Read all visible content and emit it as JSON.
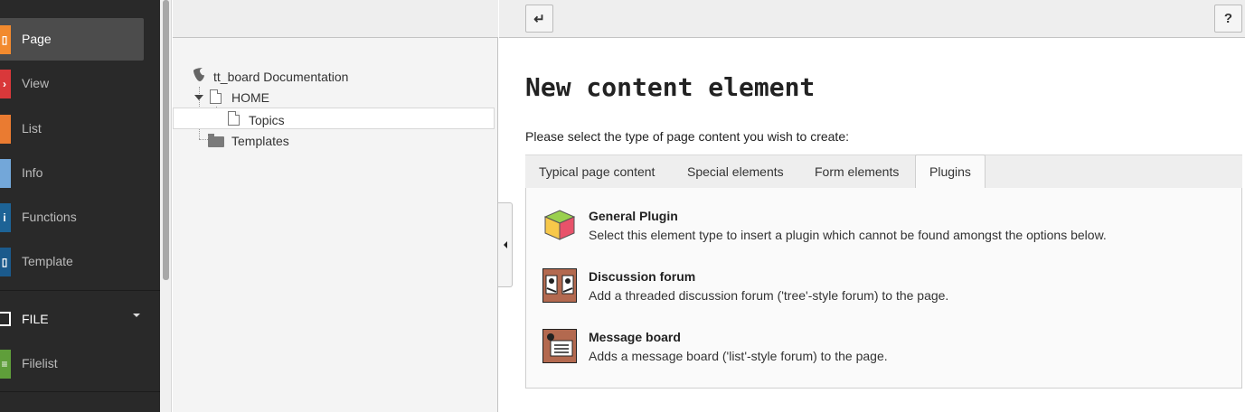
{
  "module_menu": {
    "items": [
      {
        "label": "Page",
        "color": "#f28a2e",
        "icon": "page-module-icon",
        "active": true
      },
      {
        "label": "View",
        "color": "#d9383a",
        "icon": "view-module-icon"
      },
      {
        "label": "List",
        "color": "#ea7b31",
        "icon": "list-module-icon"
      },
      {
        "label": "Info",
        "color": "#73a7d9",
        "icon": "info-module-icon"
      },
      {
        "label": "Functions",
        "color": "#1d6396",
        "icon": "functions-module-icon"
      },
      {
        "label": "Template",
        "color": "#1b5a8c",
        "icon": "template-module-icon"
      }
    ],
    "group_label": "FILE",
    "file_items": [
      {
        "label": "Filelist",
        "color": "#5f9e3a",
        "icon": "filelist-module-icon"
      }
    ]
  },
  "page_tree": {
    "root": "tt_board Documentation",
    "nodes": [
      {
        "label": "HOME",
        "icon": "page-icon"
      },
      {
        "label": "Topics",
        "icon": "page-icon",
        "selected": true
      },
      {
        "label": "Templates",
        "icon": "folder-icon"
      }
    ]
  },
  "docheader": {
    "back_icon": "↵",
    "help_icon": "?"
  },
  "content": {
    "title": "New content element",
    "intro": "Please select the type of page content you wish to create:",
    "tabs": [
      {
        "label": "Typical page content"
      },
      {
        "label": "Special elements"
      },
      {
        "label": "Form elements"
      },
      {
        "label": "Plugins",
        "active": true
      }
    ],
    "plugins": [
      {
        "title": "General Plugin",
        "desc": "Select this element type to insert a plugin which cannot be found amongst the options below.",
        "icon": "cube-plugin-icon"
      },
      {
        "title": "Discussion forum",
        "desc": "Add a threaded discussion forum ('tree'-style forum) to the page.",
        "icon": "forum-plugin-icon"
      },
      {
        "title": "Message board",
        "desc": "Adds a message board ('list'-style forum) to the page.",
        "icon": "message-board-plugin-icon"
      }
    ]
  }
}
